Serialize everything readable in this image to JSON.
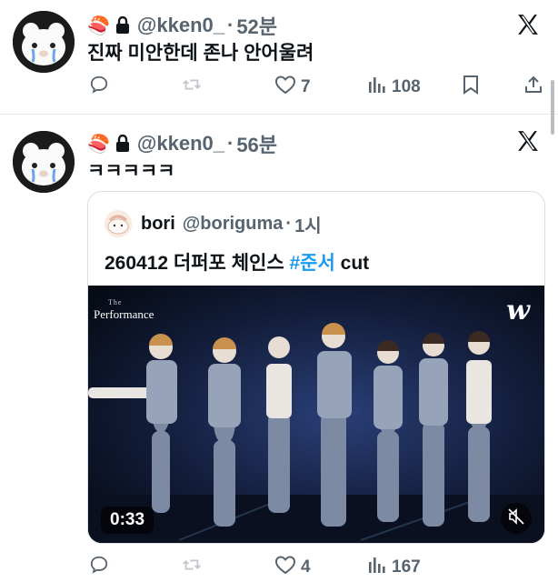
{
  "tweets": [
    {
      "emoji": "🍣",
      "handle": "@kken0_",
      "dot": "·",
      "time": "52분",
      "text": "진짜 미안한데 존나 안어울려",
      "likes": "7",
      "views": "108"
    },
    {
      "emoji": "🍣",
      "handle": "@kken0_",
      "dot": "·",
      "time": "56분",
      "text": "ㅋㅋㅋㅋㅋ",
      "likes": "4",
      "views": "167"
    }
  ],
  "quote": {
    "name": "bori",
    "handle": "@boriguma",
    "dot": "·",
    "time": "1시",
    "text_prefix": "260412 더퍼포 체인스 ",
    "hashtag": "#준서",
    "text_suffix": " cut",
    "video": {
      "duration": "0:33",
      "show_small": "The",
      "show_title": "Performance",
      "logo": "w"
    }
  },
  "colors": {
    "text": "#0f1419",
    "muted": "#57636e",
    "link": "#1d9bf0",
    "border": "#d7dde1"
  },
  "icons": [
    "lock-icon",
    "x-logo-icon",
    "reply-icon",
    "retweet-icon",
    "like-icon",
    "views-icon",
    "bookmark-icon",
    "share-icon",
    "mute-icon"
  ]
}
